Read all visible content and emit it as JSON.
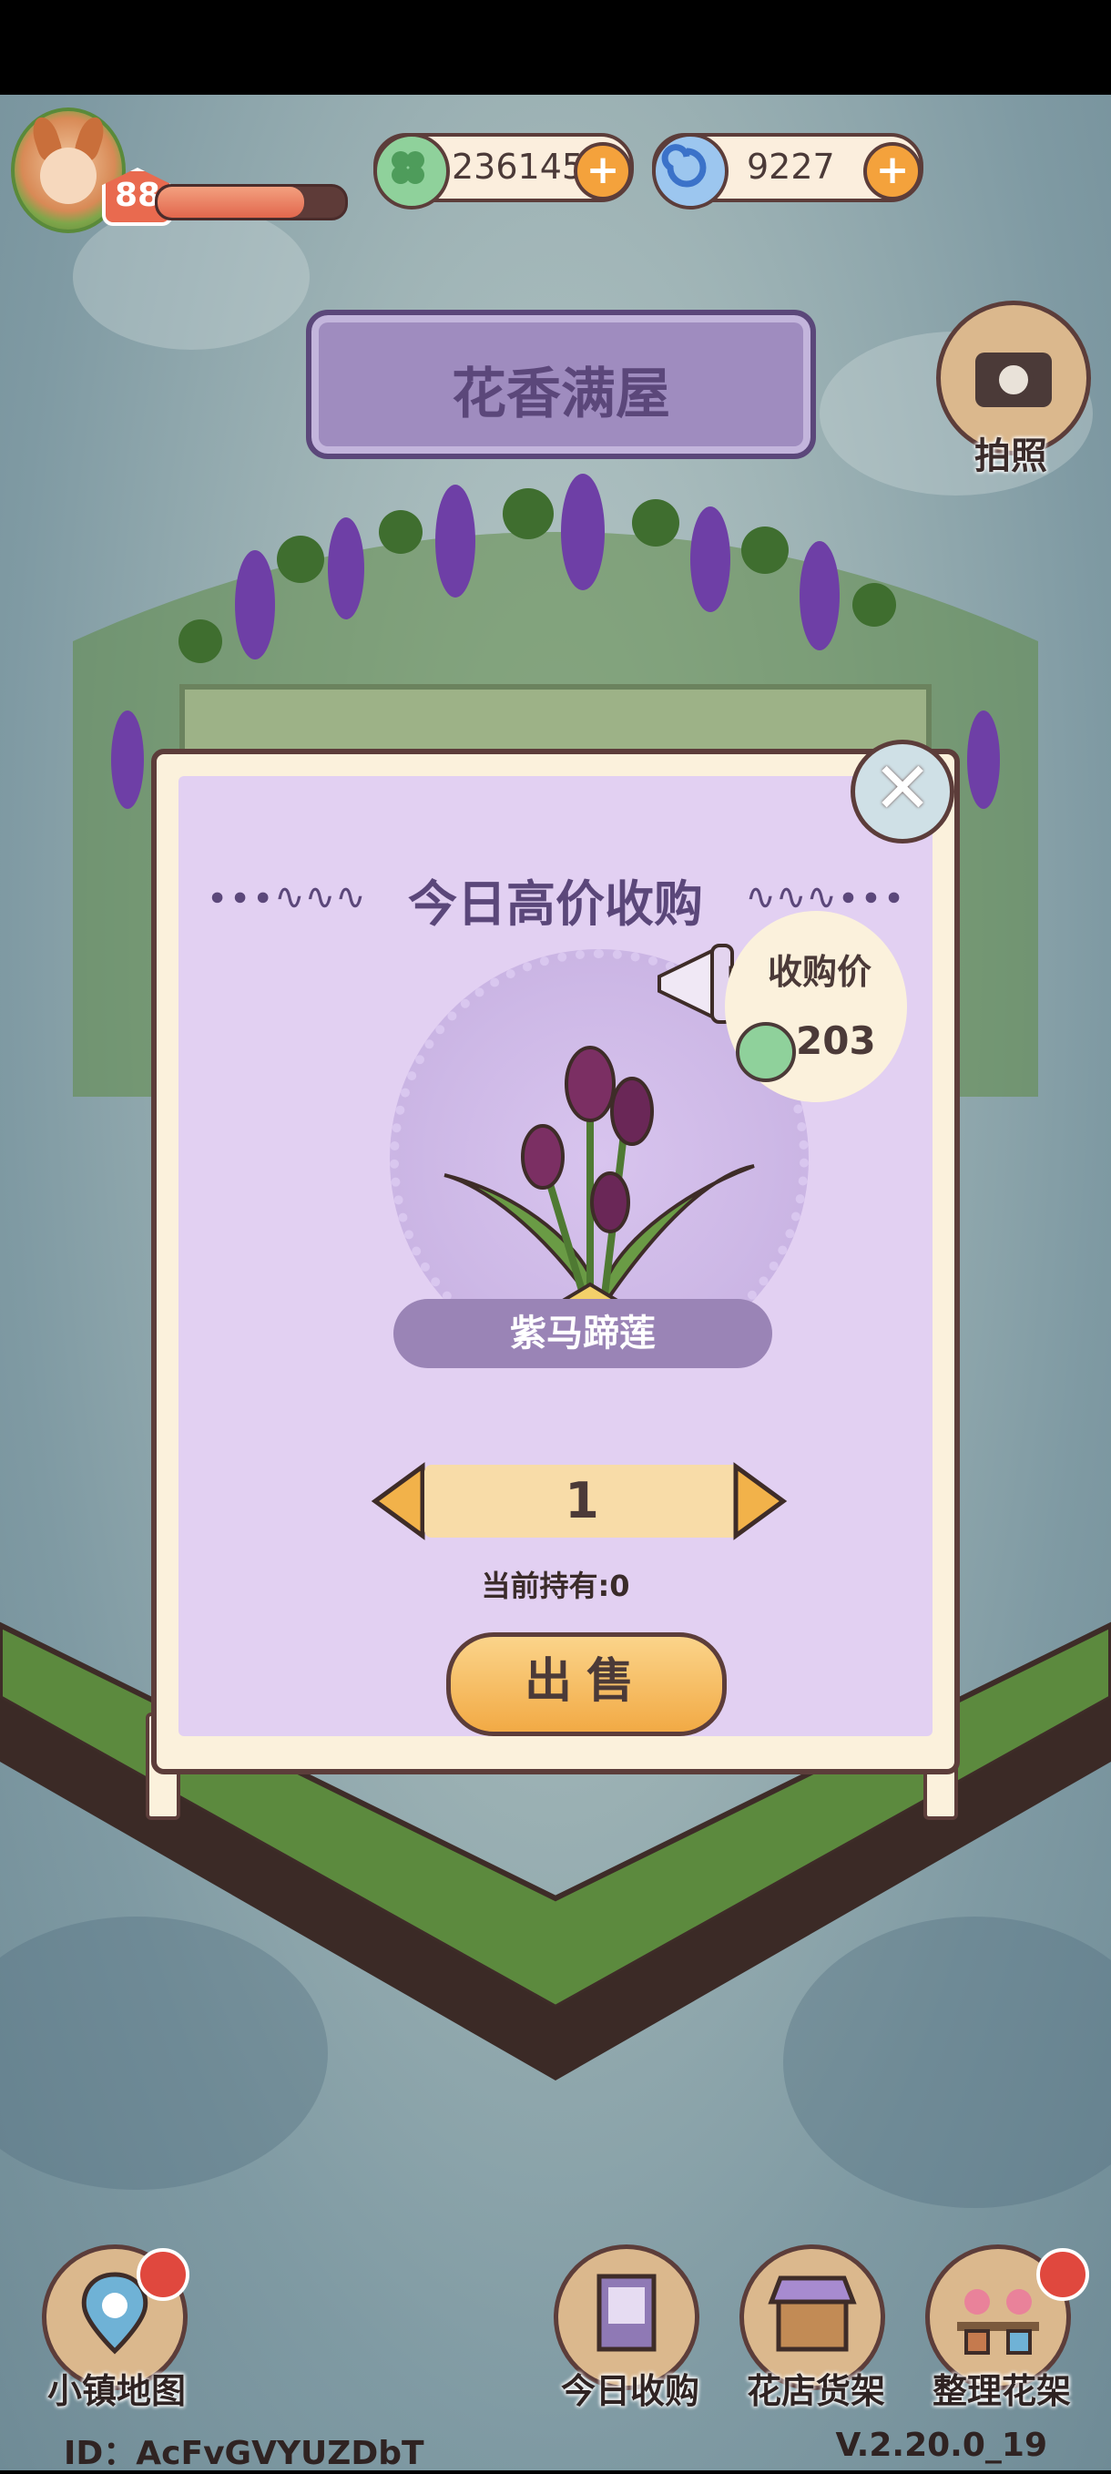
{
  "hud": {
    "level": "88",
    "xp_progress": 0.78,
    "clover_amount": "236145",
    "swirl_amount": "9227",
    "plus_symbol": "+"
  },
  "location_title": "花香满屋",
  "camera_label": "拍照",
  "dialog": {
    "title": "今日高价收购",
    "close_symbol": "✕",
    "price_label": "收购价",
    "price_value": "203",
    "item_name": "紫马蹄莲",
    "quantity": "1",
    "holding_text": "当前持有:0",
    "sell_label": "出售"
  },
  "bottom_nav": {
    "map_label": "小镇地图",
    "daily_label": "今日收购",
    "shelf_label": "花店货架",
    "arrange_label": "整理花架"
  },
  "footer": {
    "id_text": "ID：AcFvGVYUZDbT",
    "version_text": "V.2.20.0_19"
  },
  "colors": {
    "accent_purple": "#5b477a",
    "panel_lilac": "#e2d0f2",
    "sell_orange": "#f2aa45",
    "notification_red": "#e0483e"
  },
  "icons": [
    "clover-icon",
    "swirl-icon",
    "camera-icon",
    "megaphone-icon",
    "map-pin-icon",
    "close-icon"
  ]
}
